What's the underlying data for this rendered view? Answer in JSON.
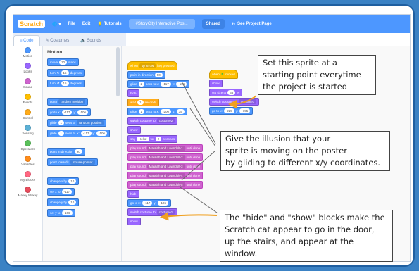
{
  "menubar": {
    "logo": "Scratch",
    "file": "File",
    "edit": "Edit",
    "tutorials": "Tutorials",
    "project_title": "#StoryCity Interactive Pos...",
    "shared": "Shared",
    "see_project_page": "See Project Page"
  },
  "tabs": {
    "code": "Code",
    "costumes": "Costumes",
    "sounds": "Sounds"
  },
  "categories": [
    {
      "label": "Motion",
      "color": "#4c97ff"
    },
    {
      "label": "Looks",
      "color": "#9966ff"
    },
    {
      "label": "Sound",
      "color": "#cf63cf"
    },
    {
      "label": "Events",
      "color": "#ffbf00"
    },
    {
      "label": "Control",
      "color": "#ffab19"
    },
    {
      "label": "Sensing",
      "color": "#5cb1d6"
    },
    {
      "label": "Operators",
      "color": "#59c059"
    },
    {
      "label": "Variables",
      "color": "#ff8c1a"
    },
    {
      "label": "My Blocks",
      "color": "#ff6680"
    },
    {
      "label": "Makey Makey",
      "color": "#e84c5c"
    }
  ],
  "palette": {
    "title": "Motion",
    "move": "move",
    "move_n": "10",
    "steps": "steps",
    "turn": "turn",
    "turn_n": "15",
    "degrees": "degrees",
    "goto": "go to",
    "random_position": "random position",
    "goto_xy": "go to x:",
    "gx": "-117",
    "y": "y:",
    "gy": "-106",
    "glide": "glide",
    "one": "1",
    "secs_to": "secs to",
    "glide_x": "x:",
    "glide_xv": "-117",
    "glide_yv": "-106",
    "point_dir": "point in direction",
    "dir_v": "90",
    "point_towards": "point towards",
    "mouse_pointer": "mouse-pointer",
    "change_x": "change x by",
    "change_x_v": "10",
    "set_x": "set x to",
    "set_x_v": "-117",
    "change_y": "change y by",
    "change_y_v": "10",
    "set_y": "set y to",
    "set_y_v": "-106"
  },
  "script1": {
    "when": "when",
    "key": "up arrow",
    "key_pressed": "key pressed",
    "point_dir": "point in direction",
    "dir_v": "90",
    "glide": "glide",
    "g1_secs": "2",
    "secs_to_x": "secs to x:",
    "g1_x": "-117",
    "y": "y:",
    "g1_y": "-106",
    "hide": "hide",
    "wait": "wait",
    "wait_v": "1",
    "seconds": "seconds",
    "g2_secs": "1",
    "g2_x": "-200",
    "g2_y": "35",
    "switch_costume": "switch costume to",
    "costume2": "costume2",
    "show": "show",
    "say": "say",
    "say_text": "Hello!",
    "for": "for",
    "say_secs": "2",
    "say_seconds": "seconds",
    "play_sound": "play sound",
    "until_done": "until done",
    "sounds": [
      "Malaiah and Lawndolt-1",
      "Malaiah and Lawndolt-2",
      "Malaiah and Lawndolt-3",
      "Malaiah and Lawndolt-4",
      "Malaiah and Lawndolt-5"
    ],
    "go_to_x": "go to x:",
    "end_x": "-117",
    "end_y": "-106",
    "costume1": "costume1"
  },
  "script2": {
    "when": "when",
    "clicked": "clicked",
    "show": "show",
    "set_size": "set size to",
    "size_v": "35",
    "percent": "%",
    "switch_costume": "switch costume to",
    "costume": "costume1",
    "go_to_x": "go to x:",
    "x_v": "-225",
    "y": "y:",
    "y_v": "-195"
  },
  "callouts": {
    "top": [
      "Set this sprite at a",
      "starting point everytime",
      "the project is started"
    ],
    "middle": [
      "Give the illusion that your",
      "sprite is moving on the poster",
      "by gliding to different x/y coordinates."
    ],
    "bottom": [
      "The \"hide\" and \"show\" blocks make the",
      "Scratch cat appear to go in the door,",
      "up the stairs, and appear at the window."
    ]
  }
}
